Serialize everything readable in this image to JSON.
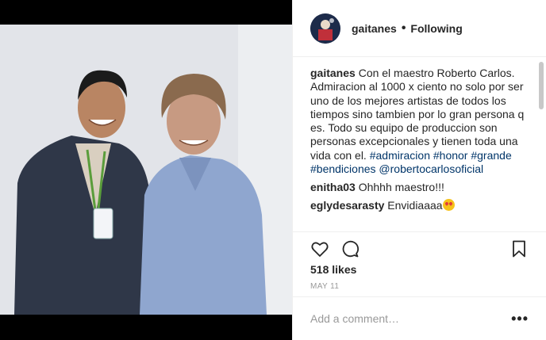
{
  "post": {
    "username": "gaitanes",
    "separator": "•",
    "follow_state": "Following",
    "caption": {
      "username": "gaitanes",
      "text": "Con el maestro Roberto Carlos. Admiracion al 1000 x ciento no solo por ser uno de los mejores artistas de todos los tiempos sino tambien por lo gran persona q es. Todo su equipo de produccion son personas excepcionales y tienen toda una vida con el.",
      "tag1": "#admiracion",
      "tag2": "#honor",
      "tag3": "#grande",
      "tag4": "#bendiciones",
      "mention": "@robertocarlosoficial"
    },
    "comments": [
      {
        "username": "enitha03",
        "text": "Ohhhh maestro!!!"
      },
      {
        "username": "eglydesarasty",
        "text": "Envidiaaaa"
      }
    ],
    "likes": "518 likes",
    "date": "MAY 11",
    "add_comment_placeholder": "Add a comment…",
    "more_label": "•••"
  },
  "icons": {
    "like": "heart-icon",
    "comment": "comment-icon",
    "save": "bookmark-icon",
    "emoji": "heart-eyes-emoji"
  },
  "colors": {
    "hashtag": "#003569",
    "muted": "#999999",
    "border": "#efefef"
  }
}
